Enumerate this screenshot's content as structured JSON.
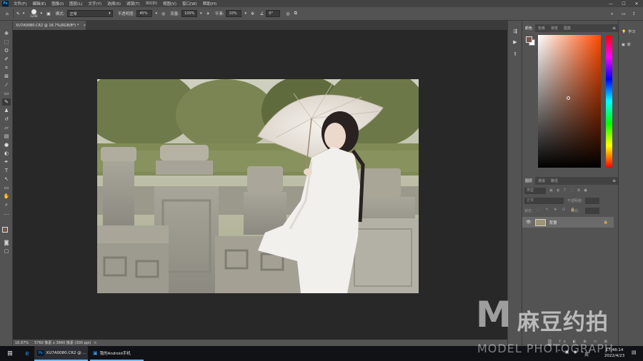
{
  "menubar": {
    "logo": "Ps",
    "items": [
      "文件(F)",
      "编辑(E)",
      "图像(I)",
      "图层(L)",
      "文字(Y)",
      "选择(S)",
      "滤镜(T)",
      "3D(D)",
      "视图(V)",
      "窗口(W)",
      "帮助(H)"
    ],
    "min": "—",
    "max": "☐",
    "close": "✕"
  },
  "options": {
    "brush_size": "1200",
    "mode_label": "模式:",
    "mode_value": "正常",
    "opacity_label": "不透明度:",
    "opacity_value": "45%",
    "flow_label": "流量:",
    "flow_value": "100%",
    "smooth_label": "平滑:",
    "smooth_value": "10%",
    "angle_value": "0°"
  },
  "document": {
    "tab_title": "XU7A0080.CR2 @ 16.7%(RGB/8*) *",
    "tab_close": "×"
  },
  "statusbar": {
    "zoom": "16.67%",
    "info": "5760 像素 x 3840 像素 (300 ppi)",
    "arrow": ">"
  },
  "color_panel": {
    "tabs": [
      "颜色",
      "色板",
      "渐变",
      "图案"
    ],
    "foreground": "#7a5548",
    "background": "#ffffff",
    "hue_color": "#ff4a00"
  },
  "layers_panel": {
    "tabs": [
      "图层",
      "通道",
      "路径"
    ],
    "kind_label": "类型",
    "blend_value": "正常",
    "opacity_label": "不透明度:",
    "lock_label": "锁定:",
    "fill_label": "填充:",
    "layer_name": "背景",
    "lock_icon": "🔒"
  },
  "far_right": {
    "learn": "学习",
    "library": "库"
  },
  "taskbar": {
    "ps_app": "XU7A0080.CR2 @ ...",
    "phone_app": "我的Android手机",
    "time": "17:48:14",
    "date": "2022/4/23",
    "lang": "英"
  },
  "watermark": {
    "brand_cn": "麻豆约拍",
    "brand_en": "MODEL PHOTOGRAPH",
    "letter": "M"
  },
  "colors": {
    "app_bg": "#535353",
    "canvas_bg": "#282828",
    "menubar": "#434343",
    "taskbar": "#111216",
    "accent": "#31a8ff"
  }
}
